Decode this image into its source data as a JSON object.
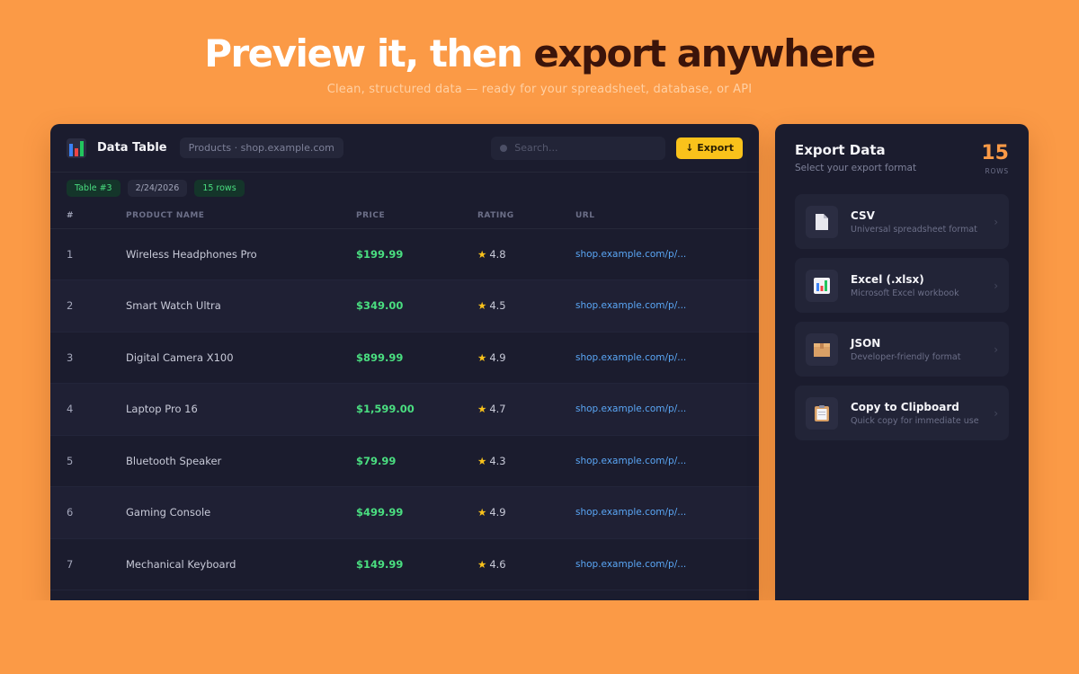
{
  "hero": {
    "title_main": "Preview it, then ",
    "title_accent": "export anywhere",
    "subtitle": "Clean, structured data — ready for your spreadsheet, database, or API"
  },
  "table_panel": {
    "title": "Data Table",
    "source": "Products · shop.example.com",
    "search_placeholder": "Search...",
    "export_label": "↓ Export",
    "badges": [
      "Table #3",
      "2/24/2026",
      "15 rows"
    ],
    "columns": [
      "#",
      "PRODUCT NAME",
      "PRICE",
      "RATING",
      "URL"
    ],
    "rows": [
      {
        "num": "1",
        "name": "Wireless Headphones Pro",
        "price": "$199.99",
        "rating": "4.8",
        "url": "shop.example.com/p/..."
      },
      {
        "num": "2",
        "name": "Smart Watch Ultra",
        "price": "$349.00",
        "rating": "4.5",
        "url": "shop.example.com/p/..."
      },
      {
        "num": "3",
        "name": "Digital Camera X100",
        "price": "$899.99",
        "rating": "4.9",
        "url": "shop.example.com/p/..."
      },
      {
        "num": "4",
        "name": "Laptop Pro 16",
        "price": "$1,599.00",
        "rating": "4.7",
        "url": "shop.example.com/p/..."
      },
      {
        "num": "5",
        "name": "Bluetooth Speaker",
        "price": "$79.99",
        "rating": "4.3",
        "url": "shop.example.com/p/..."
      },
      {
        "num": "6",
        "name": "Gaming Console",
        "price": "$499.99",
        "rating": "4.9",
        "url": "shop.example.com/p/..."
      },
      {
        "num": "7",
        "name": "Mechanical Keyboard",
        "price": "$149.99",
        "rating": "4.6",
        "url": "shop.example.com/p/..."
      }
    ]
  },
  "export_panel": {
    "title": "Export Data",
    "subtitle": "Select your export format",
    "count": "15",
    "count_label": "ROWS",
    "options": [
      {
        "name": "CSV",
        "desc": "Universal spreadsheet format",
        "icon": "file-icon"
      },
      {
        "name": "Excel (.xlsx)",
        "desc": "Microsoft Excel workbook",
        "icon": "bar-chart-icon"
      },
      {
        "name": "JSON",
        "desc": "Developer-friendly format",
        "icon": "package-icon"
      },
      {
        "name": "Copy to Clipboard",
        "desc": "Quick copy for immediate use",
        "icon": "clipboard-icon"
      }
    ]
  },
  "colors": {
    "background": "#fb9a46",
    "panel": "#1b1c2e",
    "accent_yellow": "#f9c21b",
    "price_green": "#4ade80",
    "link_blue": "#5aa6f5"
  }
}
